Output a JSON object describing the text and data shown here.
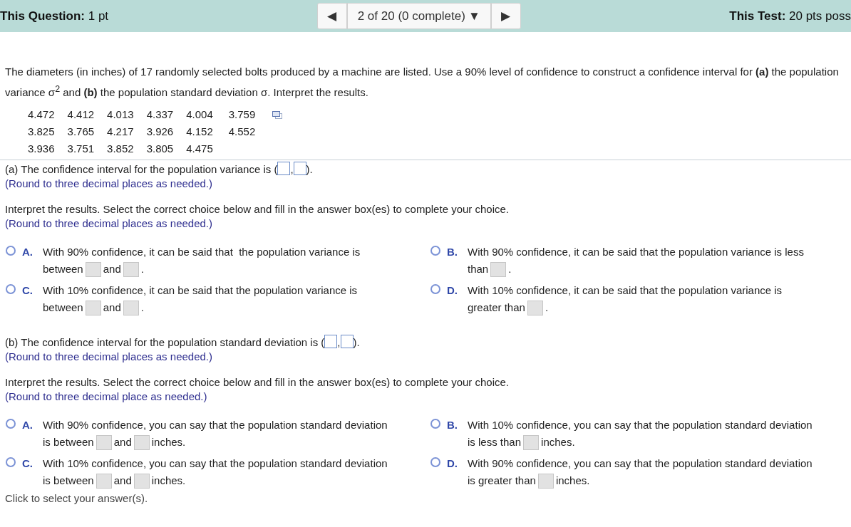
{
  "header": {
    "question_points": "**This Question:** 1 pt",
    "nav_prev": "◀",
    "nav_position": "2 of 20 (0 complete)",
    "nav_menu": "▼",
    "nav_next": "▶",
    "test_points": "**This Test:** 20 pts poss"
  },
  "question": "The diameters (in inches) of 17 randomly selected bolts produced by a machine are listed. Use a 90% level of confidence to construct a confidence interval for **(a)** the population variance σ$^{2}$ and **(b)** the population standard deviation σ. Interpret the results.",
  "data_rows": [
    [
      "4.472",
      "4.412",
      "4.013",
      "4.337",
      "4.004",
      "3.759"
    ],
    [
      "3.825",
      "3.765",
      "4.217",
      "3.926",
      "4.152",
      "4.552"
    ],
    [
      "3.936",
      "3.751",
      "3.852",
      "3.805",
      "4.475"
    ]
  ],
  "parts": [
    {
      "prompt": [
        "(a) The confidence interval for the population variance is (",
        ",",
        ")."
      ],
      "hint": "(Round to three decimal places as needed.)",
      "instruction": "Interpret the results. Select the correct choice below and fill in the answer box(es) to complete your choice.",
      "instruction_hint": "(Round to three decimal places as needed.)",
      "options": [
        {
          "letter": "A.",
          "selected": false,
          "lines": [
            [
              "With 90% confidence, it can be said that  the population variance is"
            ],
            [
              "between",
              "and",
              "."
            ]
          ]
        },
        {
          "letter": "B.",
          "selected": false,
          "lines": [
            [
              "With 90% confidence, it can be said that the population variance is less"
            ],
            [
              "than",
              "."
            ]
          ]
        },
        {
          "letter": "C.",
          "selected": false,
          "lines": [
            [
              "With 10% confidence, it can be said that the population variance is"
            ],
            [
              "between",
              "and",
              "."
            ]
          ]
        },
        {
          "letter": "D.",
          "selected": false,
          "lines": [
            [
              "With 10% confidence, it can be said that the population variance is"
            ],
            [
              "greater than",
              "."
            ]
          ]
        }
      ]
    },
    {
      "prompt": [
        "(b) The confidence interval for the population standard deviation is (",
        ",",
        ")."
      ],
      "hint": "(Round to three decimal places as needed.)",
      "instruction": "Interpret the results. Select the correct choice below and fill in the answer box(es) to complete your choice.",
      "instruction_hint": "(Round to three decimal place as needed.)",
      "options": [
        {
          "letter": "A.",
          "selected": false,
          "lines": [
            [
              "With 90% confidence, you can say that the population standard deviation"
            ],
            [
              "is between",
              "and",
              "inches."
            ]
          ]
        },
        {
          "letter": "B.",
          "selected": false,
          "lines": [
            [
              "With 10% confidence, you can say that the population standard deviation"
            ],
            [
              "is less than",
              "inches."
            ]
          ]
        },
        {
          "letter": "C.",
          "selected": false,
          "lines": [
            [
              "With 10% confidence, you can say that the population standard deviation"
            ],
            [
              "is between",
              "and",
              "inches."
            ]
          ]
        },
        {
          "letter": "D.",
          "selected": false,
          "lines": [
            [
              "With 90% confidence, you can say that the population standard deviation"
            ],
            [
              "is greater than",
              "inches."
            ]
          ]
        }
      ]
    }
  ],
  "footer": "Click to select your answer(s)."
}
